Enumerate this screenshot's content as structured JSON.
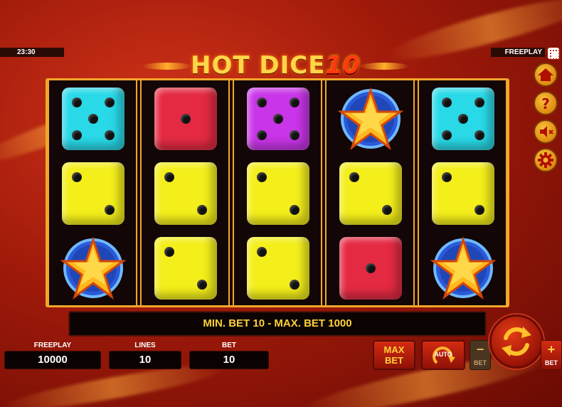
{
  "status": {
    "clock": "23:30",
    "mode": "FREEPLAY"
  },
  "logo": {
    "main": "HOT DICE",
    "number": "10"
  },
  "reels": [
    [
      "dice-5-cyan",
      "dice-2-yellow",
      "star"
    ],
    [
      "dice-1-red",
      "dice-2-yellow",
      "dice-2-yellow"
    ],
    [
      "dice-5-purple",
      "dice-2-yellow",
      "dice-2-yellow"
    ],
    [
      "star",
      "dice-2-yellow",
      "dice-1-red"
    ],
    [
      "dice-5-cyan",
      "dice-2-yellow",
      "star"
    ]
  ],
  "banner": {
    "message": "MIN. BET 10 - MAX. BET 1000"
  },
  "fields": {
    "freeplay_label": "FREEPLAY",
    "freeplay_value": "10000",
    "lines_label": "LINES",
    "lines_value": "10",
    "bet_label": "BET",
    "bet_value": "10"
  },
  "buttons": {
    "max_bet_line1": "MAX",
    "max_bet_line2": "BET",
    "auto": "AUTO",
    "bet_minus_sign": "−",
    "bet_minus_label": "BET",
    "bet_plus_sign": "+",
    "bet_plus_label": "BET"
  },
  "side_icons": [
    "home-icon",
    "help-icon",
    "sound-muted-icon",
    "settings-gear-icon"
  ],
  "colors": {
    "accent_gold": "#f2a72c",
    "text_yellow": "#ffd23a",
    "cyan_die": "#29d9e8",
    "red_die": "#e42a42",
    "purple_die": "#c935e8",
    "yellow_die": "#f4ef1a"
  }
}
